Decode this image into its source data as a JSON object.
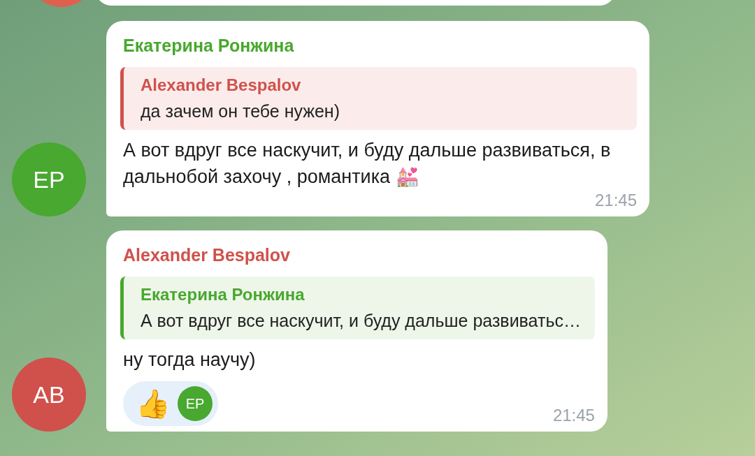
{
  "messages": [
    {
      "sender": "Екатерина Ронжина",
      "color": "#48a82f",
      "avatar": "EP",
      "reply": {
        "sender": "Alexander Bespalov",
        "color": "#d0514c",
        "text": "да зачем он тебе нужен)"
      },
      "text": "А вот вдруг все наскучит, и буду дальше развиваться, в дальнобой захочу , романтика 💒",
      "time": "21:45"
    },
    {
      "sender": "Alexander Bespalov",
      "color": "#d0514c",
      "avatar": "AB",
      "reply": {
        "sender": "Екатерина Ронжина",
        "color": "#48a82f",
        "text": "А вот вдруг все наскучит, и буду дальше развиватьс…"
      },
      "text": "ну тогда научу)",
      "reactions": [
        {
          "emoji": "👍",
          "avatar": "EP",
          "color": "#48a82f"
        }
      ],
      "time": "21:45"
    }
  ]
}
